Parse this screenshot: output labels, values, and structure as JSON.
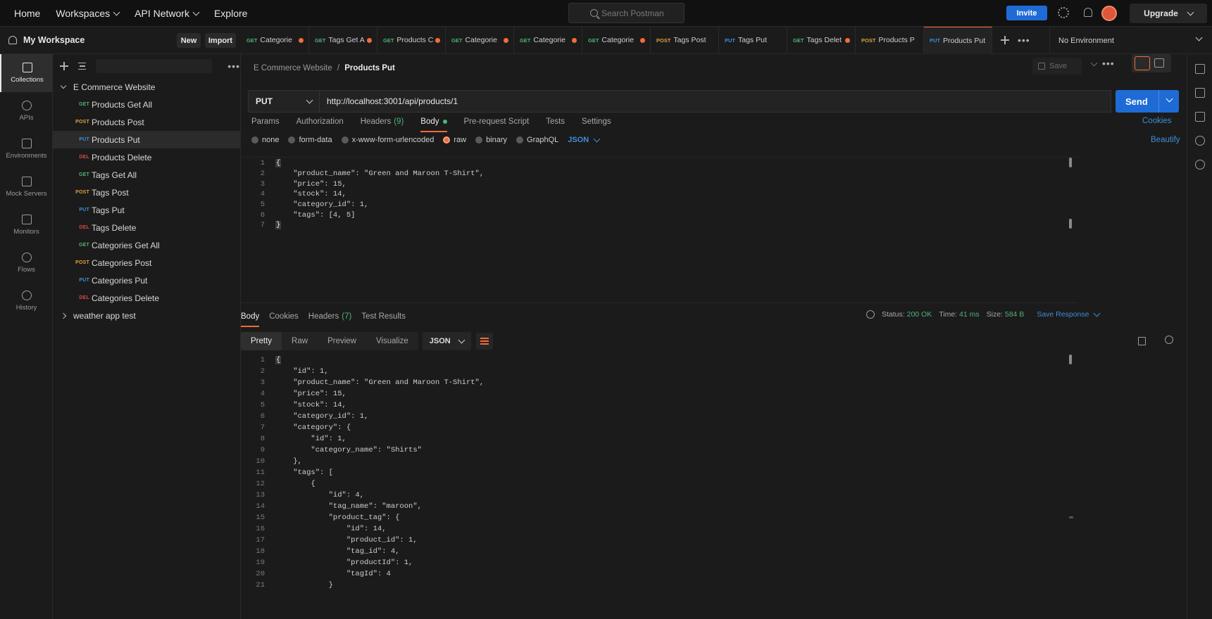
{
  "topnav": {
    "home": "Home",
    "workspaces": "Workspaces",
    "api_network": "API Network",
    "explore": "Explore",
    "search_placeholder": "Search Postman",
    "invite": "Invite",
    "upgrade": "Upgrade"
  },
  "workspace": {
    "title": "My Workspace",
    "new_label": "New",
    "import_label": "Import"
  },
  "rail": {
    "items": [
      {
        "label": "Collections",
        "icon": "collections-icon"
      },
      {
        "label": "APIs",
        "icon": "apis-icon"
      },
      {
        "label": "Environments",
        "icon": "environments-icon"
      },
      {
        "label": "Mock Servers",
        "icon": "mock-servers-icon"
      },
      {
        "label": "Monitors",
        "icon": "monitors-icon"
      },
      {
        "label": "Flows",
        "icon": "flows-icon"
      },
      {
        "label": "History",
        "icon": "history-icon"
      }
    ]
  },
  "sidebar": {
    "collection1": "E Commerce Website",
    "requests": [
      {
        "method": "GET",
        "name": "Products Get All"
      },
      {
        "method": "POST",
        "name": "Products Post"
      },
      {
        "method": "PUT",
        "name": "Products Put"
      },
      {
        "method": "DEL",
        "name": "Products Delete"
      },
      {
        "method": "GET",
        "name": "Tags Get All"
      },
      {
        "method": "POST",
        "name": "Tags Post"
      },
      {
        "method": "PUT",
        "name": "Tags Put"
      },
      {
        "method": "DEL",
        "name": "Tags Delete"
      },
      {
        "method": "GET",
        "name": "Categories Get All"
      },
      {
        "method": "POST",
        "name": "Categories Post"
      },
      {
        "method": "PUT",
        "name": "Categories Put"
      },
      {
        "method": "DEL",
        "name": "Categories Delete"
      }
    ],
    "collection2": "weather app test"
  },
  "tabs": [
    {
      "method": "GET",
      "name": "Categorie"
    },
    {
      "method": "GET",
      "name": "Tags Get A"
    },
    {
      "method": "GET",
      "name": "Products C"
    },
    {
      "method": "GET",
      "name": "Categorie"
    },
    {
      "method": "GET",
      "name": "Categorie"
    },
    {
      "method": "GET",
      "name": "Categorie"
    },
    {
      "method": "POST",
      "name": "Tags Post"
    },
    {
      "method": "PUT",
      "name": "Tags Put"
    },
    {
      "method": "GET",
      "name": "Tags Delet"
    },
    {
      "method": "POST",
      "name": "Products P"
    },
    {
      "method": "PUT",
      "name": "Products Put"
    }
  ],
  "environment": "No Environment",
  "request": {
    "breadcrumb_parent": "E Commerce Website",
    "breadcrumb_sep": "/",
    "breadcrumb_current": "Products Put",
    "save": "Save",
    "method": "PUT",
    "url": "http://localhost:3001/api/products/1",
    "send": "Send",
    "tabs": {
      "params": "Params",
      "authorization": "Authorization",
      "headers": "Headers",
      "headers_count": "(9)",
      "body": "Body",
      "pre_request": "Pre-request Script",
      "tests": "Tests",
      "settings": "Settings"
    },
    "cookies": "Cookies",
    "body_types": [
      "none",
      "form-data",
      "x-www-form-urlencoded",
      "raw",
      "binary",
      "GraphQL"
    ],
    "body_format": "JSON",
    "beautify": "Beautify",
    "body_lines": [
      {
        "n": "1",
        "t": "{"
      },
      {
        "n": "2",
        "t": "    \"product_name\": \"Green and Maroon T-Shirt\","
      },
      {
        "n": "3",
        "t": "    \"price\": 15,"
      },
      {
        "n": "4",
        "t": "    \"stock\": 14,"
      },
      {
        "n": "5",
        "t": "    \"category_id\": 1,"
      },
      {
        "n": "6",
        "t": "    \"tags\": [4, 5]"
      },
      {
        "n": "7",
        "t": "}"
      }
    ]
  },
  "response": {
    "tabs": {
      "body": "Body",
      "cookies": "Cookies",
      "headers": "Headers",
      "headers_count": "(7)",
      "test_results": "Test Results"
    },
    "status_label": "Status:",
    "status_value": "200 OK",
    "time_label": "Time:",
    "time_value": "41 ms",
    "size_label": "Size:",
    "size_value": "584 B",
    "save_response": "Save Response",
    "views": [
      "Pretty",
      "Raw",
      "Preview",
      "Visualize"
    ],
    "format": "JSON",
    "lines": [
      {
        "n": "1",
        "t": "{"
      },
      {
        "n": "2",
        "t": "    \"id\": 1,"
      },
      {
        "n": "3",
        "t": "    \"product_name\": \"Green and Maroon T-Shirt\","
      },
      {
        "n": "4",
        "t": "    \"price\": 15,"
      },
      {
        "n": "5",
        "t": "    \"stock\": 14,"
      },
      {
        "n": "6",
        "t": "    \"category_id\": 1,"
      },
      {
        "n": "7",
        "t": "    \"category\": {"
      },
      {
        "n": "8",
        "t": "        \"id\": 1,"
      },
      {
        "n": "9",
        "t": "        \"category_name\": \"Shirts\""
      },
      {
        "n": "10",
        "t": "    },"
      },
      {
        "n": "11",
        "t": "    \"tags\": ["
      },
      {
        "n": "12",
        "t": "        {"
      },
      {
        "n": "13",
        "t": "            \"id\": 4,"
      },
      {
        "n": "14",
        "t": "            \"tag_name\": \"maroon\","
      },
      {
        "n": "15",
        "t": "            \"product_tag\": {"
      },
      {
        "n": "16",
        "t": "                \"id\": 14,"
      },
      {
        "n": "17",
        "t": "                \"product_id\": 1,"
      },
      {
        "n": "18",
        "t": "                \"tag_id\": 4,"
      },
      {
        "n": "19",
        "t": "                \"productId\": 1,"
      },
      {
        "n": "20",
        "t": "                \"tagId\": 4"
      },
      {
        "n": "21",
        "t": "            }"
      }
    ]
  },
  "colors": {
    "accent": "#f26b3a",
    "primary": "#1f6bd6",
    "get": "#4fb37a",
    "post": "#e0a040",
    "put": "#3d8fd6",
    "delete": "#d44a3f"
  }
}
